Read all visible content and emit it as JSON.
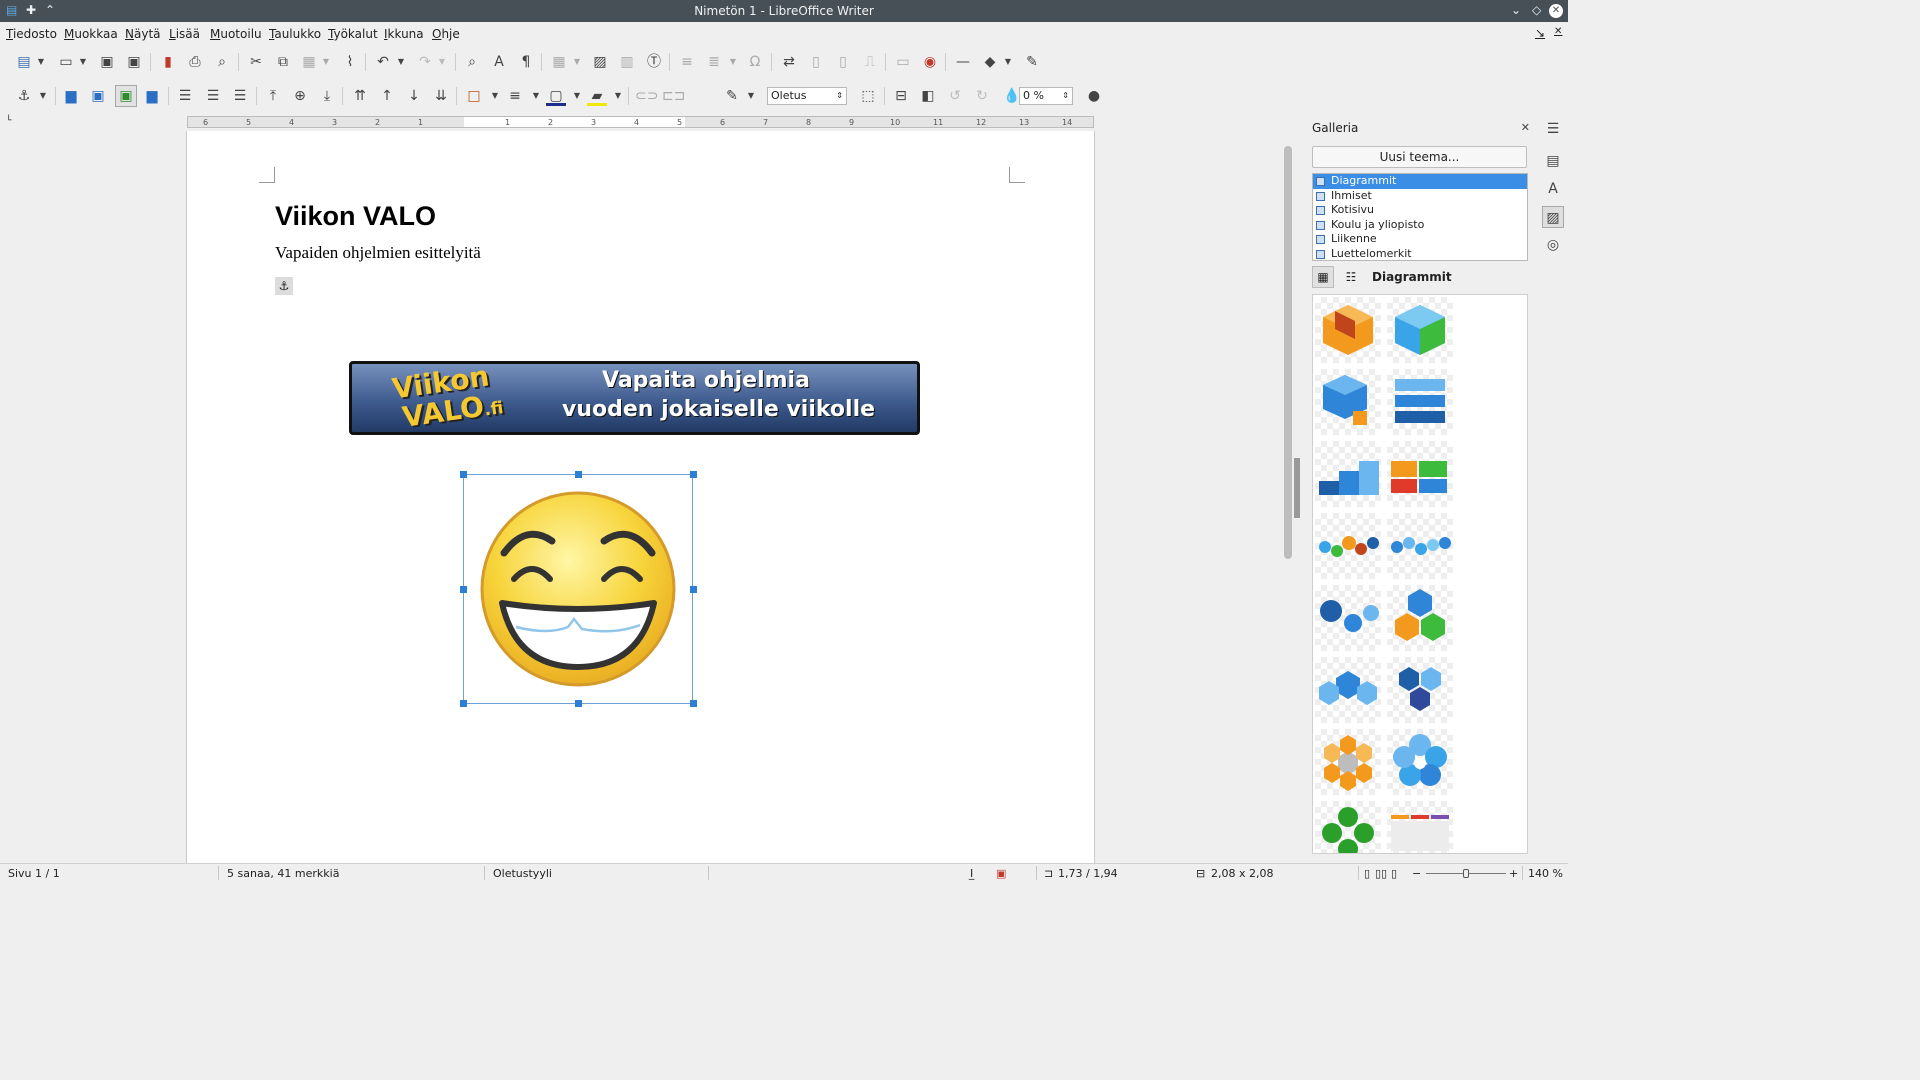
{
  "window": {
    "title": "Nimetön 1 - LibreOffice Writer"
  },
  "menu": {
    "items": [
      "Tiedosto",
      "Muokkaa",
      "Näytä",
      "Lisää",
      "Muotoilu",
      "Taulukko",
      "Työkalut",
      "Ikkuna",
      "Ohje"
    ]
  },
  "toolbar2": {
    "frame_style_value": "Oletus",
    "transparency_value": "0 %"
  },
  "ruler": {
    "ticks": [
      "6",
      "5",
      "4",
      "3",
      "2",
      "1",
      "",
      "1",
      "2",
      "3",
      "4",
      "5",
      "6",
      "7",
      "8",
      "9",
      "10",
      "11",
      "12",
      "13",
      "14"
    ]
  },
  "document": {
    "heading": "Viikon VALO",
    "subheading": "Vapaiden ohjelmien esittelyitä",
    "banner": {
      "logo_line1": "Viikon",
      "logo_line2": "VALO",
      "logo_suffix": ".fi",
      "tagline_line1": "Vapaita ohjelmia",
      "tagline_line2": "vuoden jokaiselle viikolle"
    }
  },
  "gallery": {
    "title": "Galleria",
    "new_theme_button": "Uusi teema...",
    "themes": [
      "Diagrammit",
      "Ihmiset",
      "Kotisivu",
      "Koulu ja yliopisto",
      "Liikenne",
      "Luettelomerkit"
    ],
    "selected_theme": "Diagrammit",
    "current_theme_label": "Diagrammit"
  },
  "status": {
    "page": "Sivu 1 / 1",
    "words": "5 sanaa, 41 merkkiä",
    "page_style": "Oletustyyli",
    "position": "1,73 / 1,94",
    "size": "2,08 x 2,08",
    "zoom": "140 %"
  },
  "colors": {
    "titlebar": "#475057",
    "selection": "#3a8ee6",
    "handle": "#2b7fd4",
    "banner_text": "#f5c832"
  }
}
